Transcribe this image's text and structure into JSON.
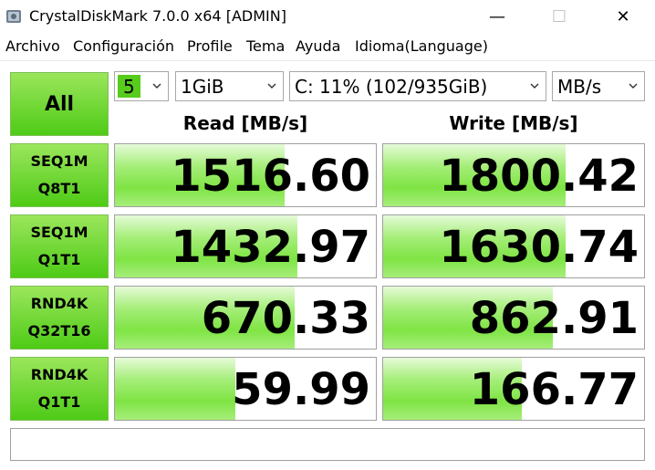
{
  "window": {
    "title": "CrystalDiskMark 7.0.0 x64 [ADMIN]",
    "minimize": "—",
    "maximize": "☐",
    "close": "✕"
  },
  "menu": [
    "Archivo",
    "Configuración",
    "Profile",
    "Tema",
    "Ayuda",
    "Idioma(Language)"
  ],
  "controls": {
    "all_label": "All",
    "count": "5",
    "size": "1GiB",
    "drive": "C: 11% (102/935GiB)",
    "unit": "MB/s"
  },
  "headers": {
    "read": "Read [MB/s]",
    "write": "Write [MB/s]"
  },
  "rows": [
    {
      "line1": "SEQ1M",
      "line2": "Q8T1",
      "read": "1516.60",
      "write": "1800.42",
      "read_fill": 0.65,
      "write_fill": 0.7
    },
    {
      "line1": "SEQ1M",
      "line2": "Q1T1",
      "read": "1432.97",
      "write": "1630.74",
      "read_fill": 0.7,
      "write_fill": 0.7
    },
    {
      "line1": "RND4K",
      "line2": "Q32T16",
      "read": "670.33",
      "write": "862.91",
      "read_fill": 0.69,
      "write_fill": 0.65
    },
    {
      "line1": "RND4K",
      "line2": "Q1T1",
      "read": "59.99",
      "write": "166.77",
      "read_fill": 0.46,
      "write_fill": 0.53
    }
  ],
  "comment": "",
  "colors": {
    "accent_green": "#4ecb16",
    "bar_green": "#7fe444"
  }
}
